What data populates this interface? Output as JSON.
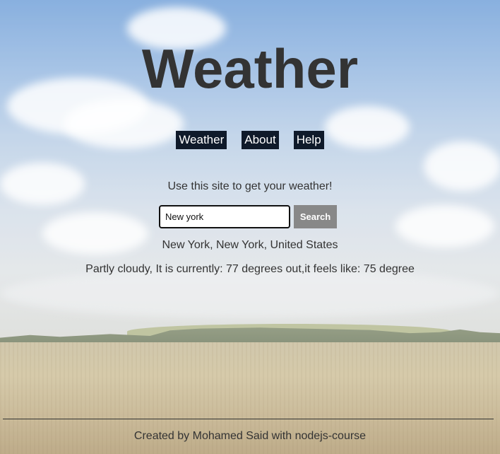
{
  "header": {
    "title": "Weather"
  },
  "nav": {
    "items": [
      {
        "label": "Weather"
      },
      {
        "label": "About"
      },
      {
        "label": "Help"
      }
    ]
  },
  "main": {
    "intro": "Use this site to get your weather!",
    "search": {
      "value": "New york",
      "button_label": "Search"
    },
    "location": "New York, New York, United States",
    "forecast": "Partly cloudy, It is currently: 77 degrees out,it feels like: 75 degree"
  },
  "footer": {
    "text": "Created by Mohamed Said with nodejs-course"
  },
  "colors": {
    "nav_background": "#0f1a2a",
    "button_background": "#888888",
    "text": "#333333"
  }
}
